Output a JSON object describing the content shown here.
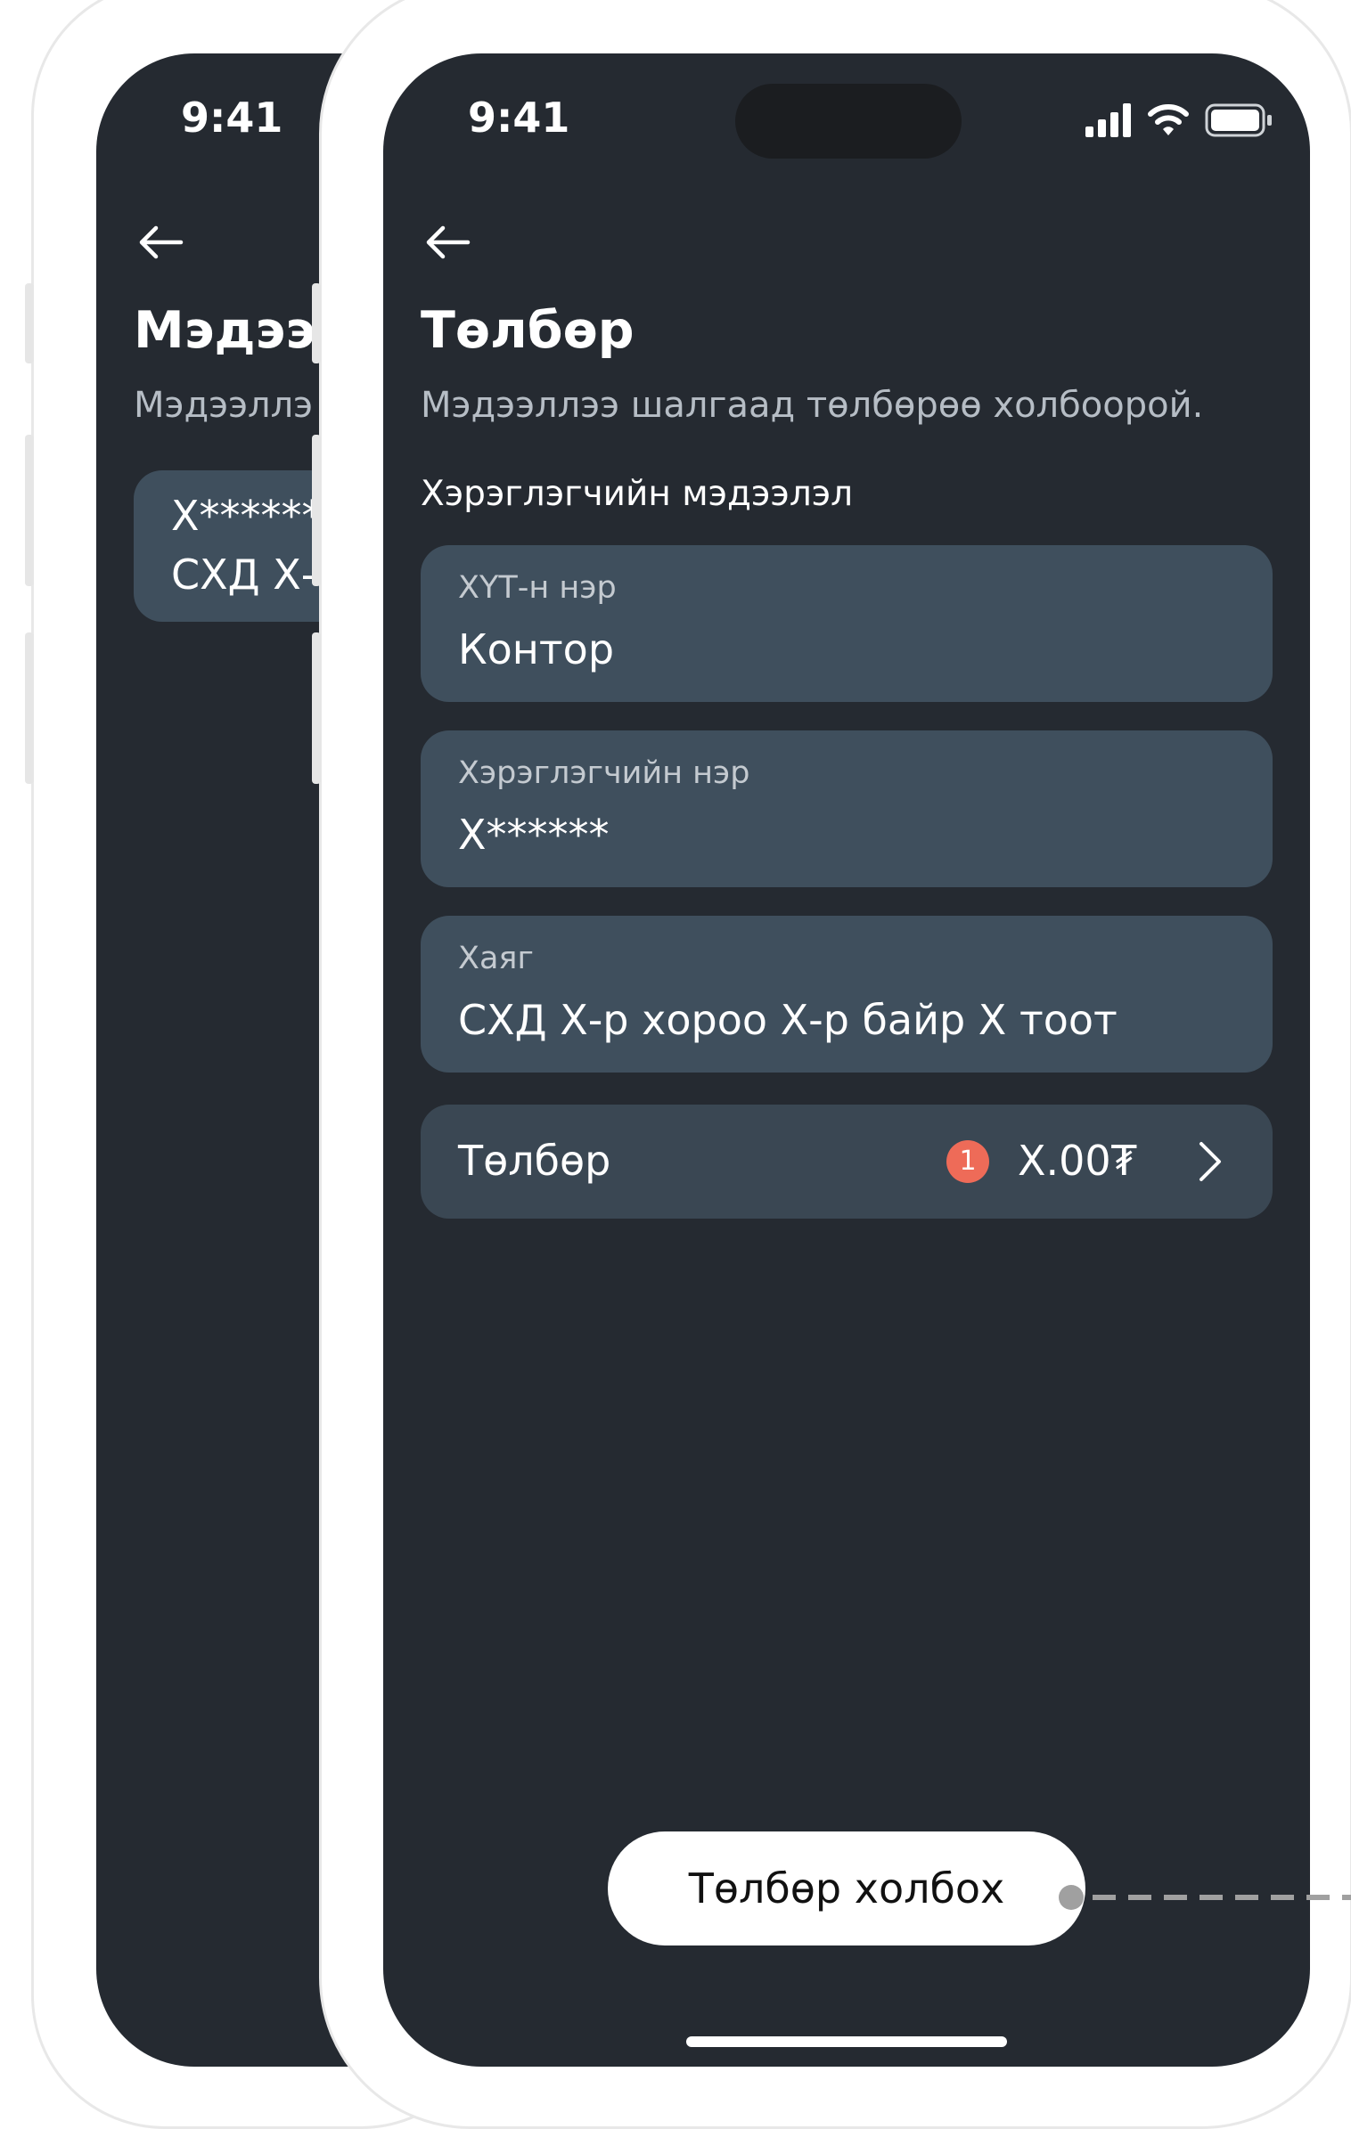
{
  "back_screen": {
    "status_time": "9:41",
    "title": "Мэдээл",
    "subtitle": "Мэдээллэ",
    "card_line1": "Х******",
    "card_line2": "СХД Х-р"
  },
  "front_screen": {
    "status_time": "9:41",
    "title": "Төлбөр",
    "subtitle": "Мэдээллээ шалгаад төлбөрөө холбоорой.",
    "section_title": "Хэрэглэгчийн мэдээлэл",
    "fields": [
      {
        "label": "ХҮТ-н нэр",
        "value": "Контор"
      },
      {
        "label": "Хэрэглэгчийн нэр",
        "value": "Х******"
      },
      {
        "label": "Хаяг",
        "value": "СХД Х-р хороо Х-р байр Х тоот"
      }
    ],
    "payment": {
      "label": "Төлбөр",
      "badge": "1",
      "amount": "Х.00₮"
    },
    "cta_label": "Төлбөр холбох"
  },
  "icons": [
    "back-arrow-icon",
    "signal-icon",
    "wifi-icon",
    "battery-icon",
    "chevron-right-icon"
  ],
  "colors": {
    "screen_bg": "#252a31",
    "card_bg": "#3f4f5d",
    "badge": "#ee6b58",
    "connector": "#9a9a9a"
  }
}
